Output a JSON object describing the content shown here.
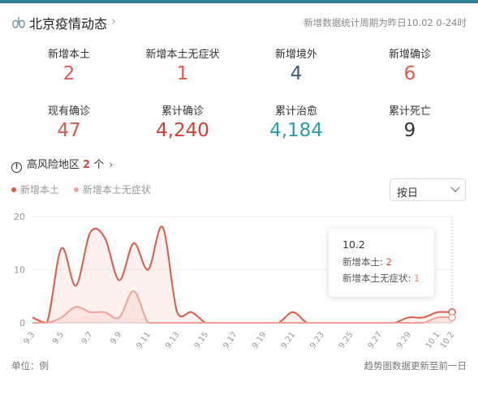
{
  "header": {
    "title": "北京疫情动态",
    "period": "新增数据统计周期为昨日10.02 0-24时"
  },
  "stats": [
    {
      "label": "新增本土",
      "value": "2",
      "color": "#e5574b"
    },
    {
      "label": "新增本土无症状",
      "value": "1",
      "color": "#e5574b"
    },
    {
      "label": "新增境外",
      "value": "4",
      "color": "#3f5b8c"
    },
    {
      "label": "新增确诊",
      "value": "6",
      "color": "#e5574b"
    },
    {
      "label": "现有确诊",
      "value": "47",
      "color": "#e5574b"
    },
    {
      "label": "累计确诊",
      "value": "4,240",
      "color": "#d63c33"
    },
    {
      "label": "累计治愈",
      "value": "4,184",
      "color": "#2a9fa6"
    },
    {
      "label": "累计死亡",
      "value": "9",
      "color": "#333333"
    }
  ],
  "risk": {
    "label": "高风险地区",
    "count": "2",
    "unit": "个"
  },
  "legend": [
    {
      "name": "新增本土",
      "color": "#e05a44"
    },
    {
      "name": "新增本土无症状",
      "color": "#f2a096"
    }
  ],
  "select": {
    "value": "按日"
  },
  "tooltip": {
    "date": "10.2",
    "row1_label": "新增本土:",
    "row1_value": "2",
    "row2_label": "新增本土无症状:",
    "row2_value": "1"
  },
  "footer": {
    "unit": "单位：例",
    "note": "趋势图数据更新至前一日"
  },
  "chart_data": {
    "type": "area",
    "ylim": [
      0,
      20
    ],
    "yticks": [
      "0",
      "10",
      "20"
    ],
    "x": [
      "9.3",
      "9.4",
      "9.5",
      "9.6",
      "9.7",
      "9.8",
      "9.9",
      "9.10",
      "9.11",
      "9.12",
      "9.13",
      "9.14",
      "9.15",
      "9.16",
      "9.17",
      "9.18",
      "9.19",
      "9.20",
      "9.21",
      "9.22",
      "9.23",
      "9.24",
      "9.25",
      "9.26",
      "9.27",
      "9.28",
      "9.29",
      "9.30",
      "10.1",
      "10.2"
    ],
    "xticks": [
      "9.3",
      "9.5",
      "9.7",
      "9.9",
      "9.11",
      "9.13",
      "9.15",
      "9.17",
      "9.19",
      "9.21",
      "9.23",
      "9.25",
      "9.27",
      "9.29",
      "10.1",
      "10.2"
    ],
    "series": [
      {
        "name": "新增本土",
        "color": "#e05a44",
        "values": [
          1,
          0,
          14,
          7,
          17,
          16,
          8,
          15,
          10,
          18,
          2,
          2,
          0,
          0,
          0,
          0,
          0,
          0,
          2,
          0,
          0,
          0,
          0,
          0,
          0,
          0,
          1,
          1,
          2,
          2
        ]
      },
      {
        "name": "新增本土无症状",
        "color": "#f2a096",
        "values": [
          0,
          0,
          1,
          3,
          2,
          2,
          1,
          6,
          0,
          0,
          0,
          0,
          0,
          0,
          0,
          0,
          0,
          0,
          0,
          0,
          0,
          0,
          0,
          0,
          0,
          0,
          0,
          0,
          1,
          1
        ]
      }
    ]
  }
}
